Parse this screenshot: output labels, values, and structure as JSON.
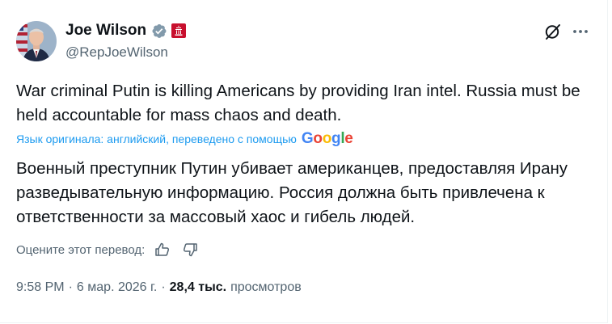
{
  "author": {
    "name": "Joe Wilson",
    "handle": "@RepJoeWilson"
  },
  "tweet": {
    "text": "War criminal Putin is killing Americans by providing Iran intel. Russia must be held accountable for mass chaos and death.",
    "translation_note": "Язык оригинала: английский, переведено с помощью",
    "translation_provider": "Google",
    "translated_text": "Военный преступник Путин убивает американцев, предоставляя Ирану разведывательную информацию. Россия должна быть привлечена к ответственности за массовый хаос и гибель людей."
  },
  "rating": {
    "label": "Оцените этот перевод:"
  },
  "meta": {
    "time": "9:58 PM",
    "separator": "·",
    "date": "6 мар. 2026 г.",
    "views_count": "28,4 тыс.",
    "views_label": "просмотров"
  },
  "colors": {
    "text": "#0f1419",
    "secondary": "#536471",
    "link": "#1d9bf0",
    "verified": "#829aab",
    "affiliation": "#c8102e"
  },
  "icons": {
    "verified": "verified-badge-icon",
    "affiliation": "us-government-affiliation-icon",
    "grok": "grok-icon",
    "more": "more-icon",
    "thumbs_up": "thumbs-up-icon",
    "thumbs_down": "thumbs-down-icon"
  }
}
